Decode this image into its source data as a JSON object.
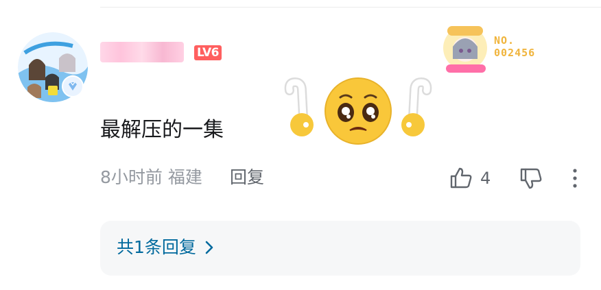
{
  "comment": {
    "username": "",
    "level": "LV6",
    "fan_badge_number": "NO.\n002456",
    "text": "最解压的一集",
    "time": "8小时前",
    "location": "福建",
    "reply_label": "回复",
    "like_count": "4",
    "replies_summary": "共1条回复"
  },
  "icons": {
    "like": "thumb-up-icon",
    "dislike": "thumb-down-icon",
    "more": "more-vertical-icon",
    "chevron": "chevron-right-icon"
  },
  "colors": {
    "level_badge": "#ff5f5f",
    "link_blue": "#00699d",
    "meta_gray": "#9499a0",
    "text_dark": "#18191c",
    "fan_gold": "#f0b43c"
  }
}
